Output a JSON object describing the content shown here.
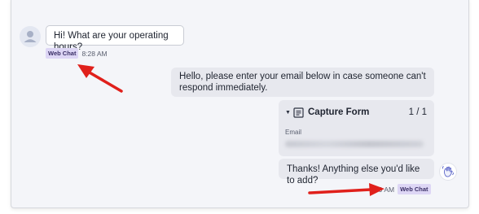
{
  "chat": {
    "incoming": {
      "text": "Hi! What are your operating hours?",
      "channel": "Web Chat",
      "time": "8:28 AM"
    },
    "outgoing_prompt": {
      "text": "Hello, please enter your email below in case someone can't respond immediately."
    },
    "capture_form": {
      "title": "Capture Form",
      "count": "1 / 1",
      "field_label": "Email"
    },
    "outgoing_followup": {
      "text": "Thanks! Anything else you'd like to add?",
      "time": "29 AM",
      "channel": "Web Chat"
    }
  },
  "colors": {
    "frame_bg": "#f4f5f9",
    "bubble_out_bg": "#e7e8ee",
    "badge_bg": "#ddd6f5",
    "arrow": "#e0201b"
  },
  "icons": {
    "avatar": "user-icon",
    "form": "form-icon",
    "caret": "caret-down-icon",
    "wave": "waving-hand-icon"
  }
}
